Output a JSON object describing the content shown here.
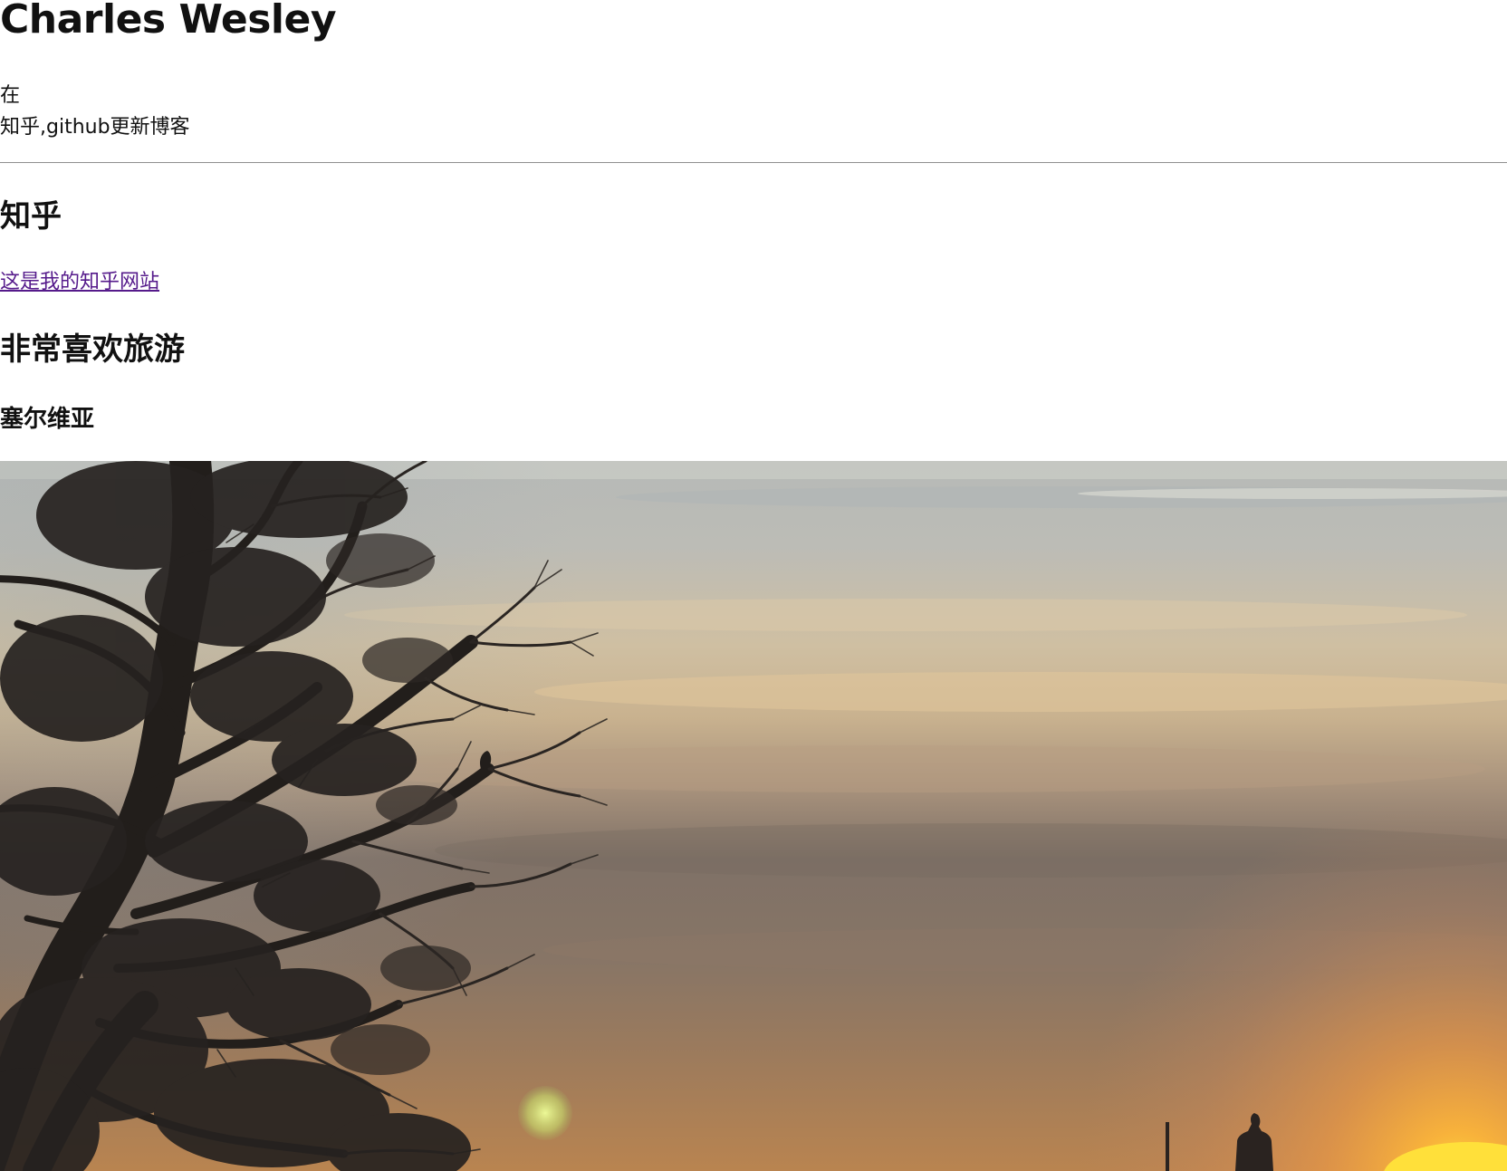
{
  "header": {
    "title": "Charles Wesley"
  },
  "intro": {
    "line1": "在",
    "line2": "知乎,github更新博客"
  },
  "zhihu_section": {
    "heading": "知乎",
    "link_text": "这是我的知乎网站"
  },
  "travel_section": {
    "heading": "非常喜欢旅游",
    "subheading": "塞尔维亚"
  },
  "photo": {
    "subject": "sunset-tree-silhouette-photo",
    "colors": {
      "sky_top": "#b3b5b3",
      "sky_mid": "#cdb89a",
      "sky_low": "#8c7a68",
      "sun_glow": "#f6a33a",
      "sun_core": "#ffd23a",
      "tree": "#221e1b"
    }
  }
}
